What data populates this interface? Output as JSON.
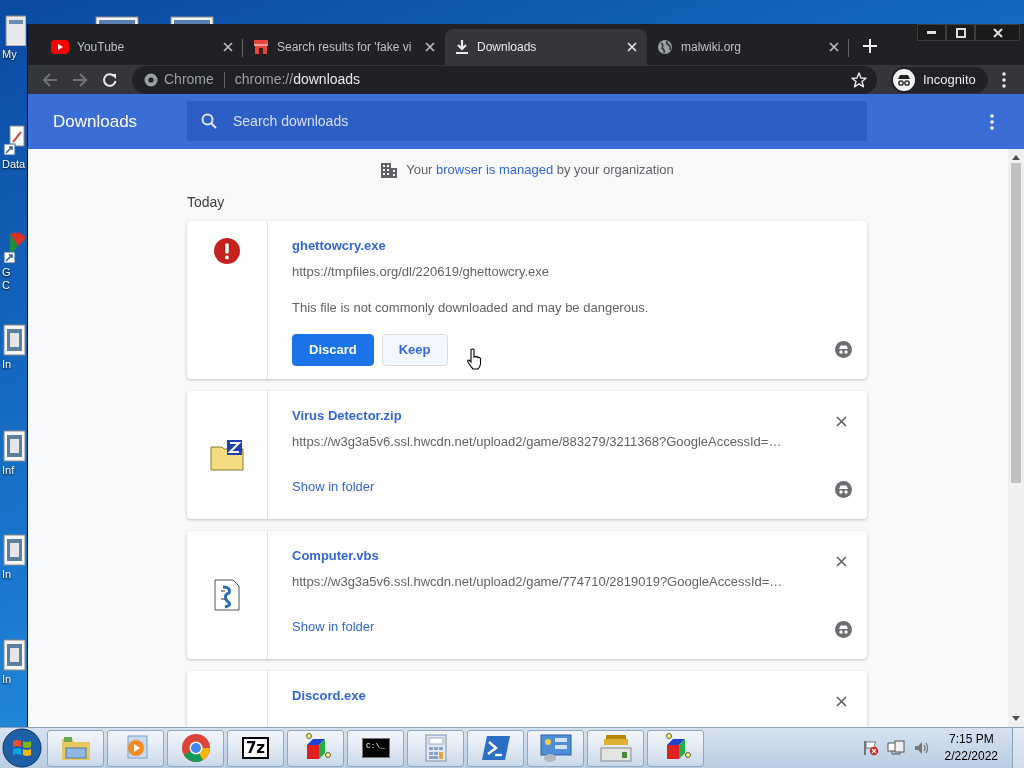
{
  "desktop_icons": [
    {
      "label": "My"
    },
    {
      "label": "Data"
    },
    {
      "label": "G\nC"
    },
    {
      "label": "In"
    },
    {
      "label": "Inf"
    },
    {
      "label": "In"
    },
    {
      "label": "In"
    }
  ],
  "browser": {
    "tabs": [
      {
        "kind": "youtube",
        "title": "YouTube",
        "selected": false
      },
      {
        "kind": "store",
        "title": "Search results for 'fake vi",
        "selected": false
      },
      {
        "kind": "download",
        "title": "Downloads",
        "selected": true
      },
      {
        "kind": "globe",
        "title": "malwiki.org",
        "selected": false
      }
    ],
    "toolbar": {
      "chip": "Chrome",
      "url_scheme": "chrome://",
      "url_path": "downloads",
      "bookmarked": false,
      "profile": "Incognito"
    }
  },
  "page": {
    "title": "Downloads",
    "search": {
      "placeholder": "Search downloads"
    },
    "managed_notice": {
      "before": "Your ",
      "link": "browser is managed",
      "after": " by your organization"
    },
    "section": "Today",
    "downloads": [
      {
        "kind": "dangerous",
        "name": "ghettowcry.exe",
        "url": "https://tmpfiles.org/dl/220619/ghettowcry.exe",
        "warning": "This file is not commonly downloaded and may be dangerous.",
        "buttons": [
          {
            "label": "Discard",
            "primary": true,
            "hovered": false
          },
          {
            "label": "Keep",
            "primary": false,
            "hovered": true
          }
        ],
        "removable": false
      },
      {
        "kind": "archive",
        "name": "Virus Detector.zip",
        "url": "https://w3g3a5v6.ssl.hwcdn.net/upload2/game/883279/3211368?GoogleAccessId=…",
        "action": "Show in folder",
        "removable": true
      },
      {
        "kind": "script",
        "name": "Computer.vbs",
        "url": "https://w3g3a5v6.ssl.hwcdn.net/upload2/game/774710/2819019?GoogleAccessId=…",
        "action": "Show in folder",
        "removable": true
      },
      {
        "kind": "file",
        "name": "Discord.exe",
        "removable": true
      }
    ]
  },
  "taskbar": {
    "apps": [
      {
        "kind": "explorer"
      },
      {
        "kind": "media"
      },
      {
        "kind": "chrome"
      },
      {
        "kind": "sevenzip",
        "label": "7z"
      },
      {
        "kind": "cube"
      },
      {
        "kind": "console",
        "label": "C:\\_"
      },
      {
        "kind": "calculator"
      },
      {
        "kind": "powershell"
      },
      {
        "kind": "control"
      },
      {
        "kind": "drive"
      },
      {
        "kind": "cube"
      }
    ],
    "time": "7:15 PM",
    "date": "2/22/2022"
  }
}
